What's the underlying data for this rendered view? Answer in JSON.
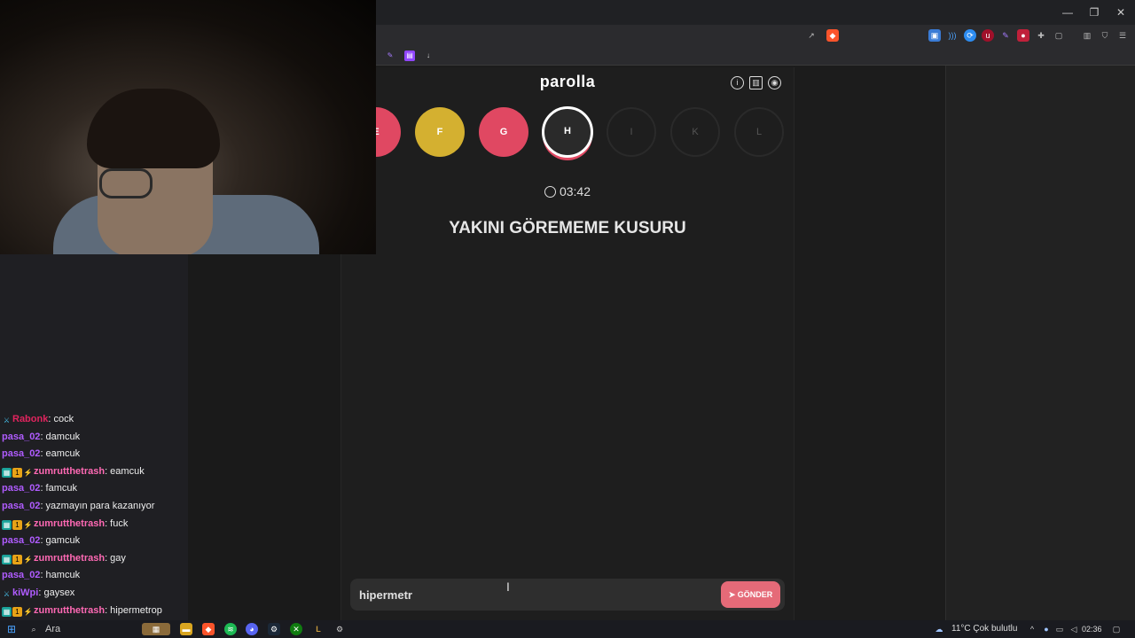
{
  "browser": {
    "window_controls": {
      "minimize": "—",
      "restore": "❐",
      "close": "✕"
    }
  },
  "game": {
    "title": "parolla",
    "letters": [
      {
        "label": "E",
        "state": "wrong"
      },
      {
        "label": "F",
        "state": "passed"
      },
      {
        "label": "G",
        "state": "wrong"
      },
      {
        "label": "H",
        "state": "active"
      },
      {
        "label": "I",
        "state": "pending"
      },
      {
        "label": "K",
        "state": "pending"
      },
      {
        "label": "L",
        "state": "pending"
      }
    ],
    "timer": "03:42",
    "question": "YAKINI GÖREMEME KUSURU",
    "answer_value": "hipermetr",
    "send_label": "GÖNDER",
    "colors": {
      "wrong": "#e04862",
      "passed": "#d4b030",
      "send": "#e56a78"
    }
  },
  "chat": {
    "messages": [
      {
        "user": "Rabonk",
        "text": ": cock",
        "color": "#e0245e",
        "badges": [
          "sword"
        ]
      },
      {
        "user": "pasa_02",
        "text": ": damcuk",
        "color": "#b05cff",
        "badges": []
      },
      {
        "user": "pasa_02",
        "text": ": eamcuk",
        "color": "#b05cff",
        "badges": []
      },
      {
        "user": "zumrutthetrash",
        "text": ": eamcuk",
        "color": "#ff69b4",
        "badges": [
          "sub",
          "one",
          "bits"
        ]
      },
      {
        "user": "pasa_02",
        "text": ": famcuk",
        "color": "#b05cff",
        "badges": []
      },
      {
        "user": "pasa_02",
        "text": ": yazmayın para kazanıyor",
        "color": "#b05cff",
        "badges": []
      },
      {
        "user": "zumrutthetrash",
        "text": ": fuck",
        "color": "#ff69b4",
        "badges": [
          "sub",
          "one",
          "bits"
        ]
      },
      {
        "user": "pasa_02",
        "text": ": gamcuk",
        "color": "#b05cff",
        "badges": []
      },
      {
        "user": "zumrutthetrash",
        "text": ": gay",
        "color": "#ff69b4",
        "badges": [
          "sub",
          "one",
          "bits"
        ]
      },
      {
        "user": "pasa_02",
        "text": ": hamcuk",
        "color": "#b05cff",
        "badges": []
      },
      {
        "user": "kiWpi",
        "text": ": gaysex",
        "color": "#b05cff",
        "badges": [
          "sword"
        ]
      },
      {
        "user": "zumrutthetrash",
        "text": ": hipermetrop",
        "color": "#ff69b4",
        "badges": [
          "sub",
          "one",
          "bits"
        ]
      }
    ]
  },
  "taskbar": {
    "search_label": "Ara",
    "weather": "11°C  Çok bulutlu",
    "clock": "02:36"
  }
}
